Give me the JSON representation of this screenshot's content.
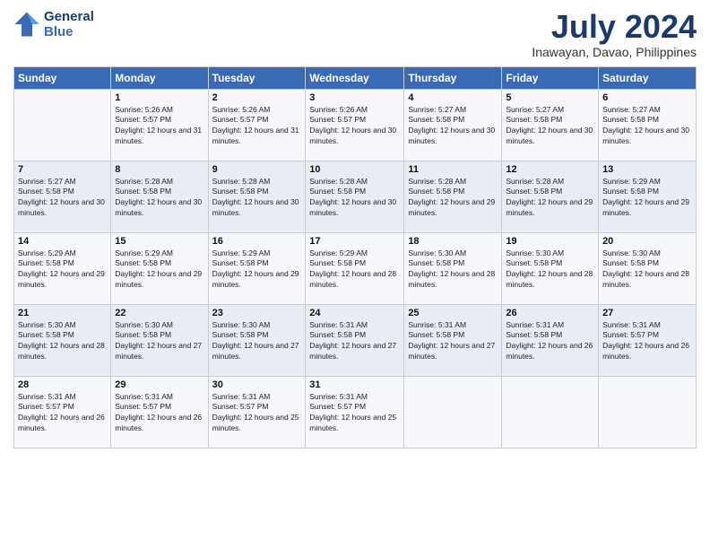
{
  "logo": {
    "line1": "General",
    "line2": "Blue"
  },
  "title": "July 2024",
  "location": "Inawayan, Davao, Philippines",
  "days_of_week": [
    "Sunday",
    "Monday",
    "Tuesday",
    "Wednesday",
    "Thursday",
    "Friday",
    "Saturday"
  ],
  "weeks": [
    [
      {
        "day": "",
        "sunrise": "",
        "sunset": "",
        "daylight": ""
      },
      {
        "day": "1",
        "sunrise": "Sunrise: 5:26 AM",
        "sunset": "Sunset: 5:57 PM",
        "daylight": "Daylight: 12 hours and 31 minutes."
      },
      {
        "day": "2",
        "sunrise": "Sunrise: 5:26 AM",
        "sunset": "Sunset: 5:57 PM",
        "daylight": "Daylight: 12 hours and 31 minutes."
      },
      {
        "day": "3",
        "sunrise": "Sunrise: 5:26 AM",
        "sunset": "Sunset: 5:57 PM",
        "daylight": "Daylight: 12 hours and 30 minutes."
      },
      {
        "day": "4",
        "sunrise": "Sunrise: 5:27 AM",
        "sunset": "Sunset: 5:58 PM",
        "daylight": "Daylight: 12 hours and 30 minutes."
      },
      {
        "day": "5",
        "sunrise": "Sunrise: 5:27 AM",
        "sunset": "Sunset: 5:58 PM",
        "daylight": "Daylight: 12 hours and 30 minutes."
      },
      {
        "day": "6",
        "sunrise": "Sunrise: 5:27 AM",
        "sunset": "Sunset: 5:58 PM",
        "daylight": "Daylight: 12 hours and 30 minutes."
      }
    ],
    [
      {
        "day": "7",
        "sunrise": "Sunrise: 5:27 AM",
        "sunset": "Sunset: 5:58 PM",
        "daylight": "Daylight: 12 hours and 30 minutes."
      },
      {
        "day": "8",
        "sunrise": "Sunrise: 5:28 AM",
        "sunset": "Sunset: 5:58 PM",
        "daylight": "Daylight: 12 hours and 30 minutes."
      },
      {
        "day": "9",
        "sunrise": "Sunrise: 5:28 AM",
        "sunset": "Sunset: 5:58 PM",
        "daylight": "Daylight: 12 hours and 30 minutes."
      },
      {
        "day": "10",
        "sunrise": "Sunrise: 5:28 AM",
        "sunset": "Sunset: 5:58 PM",
        "daylight": "Daylight: 12 hours and 30 minutes."
      },
      {
        "day": "11",
        "sunrise": "Sunrise: 5:28 AM",
        "sunset": "Sunset: 5:58 PM",
        "daylight": "Daylight: 12 hours and 29 minutes."
      },
      {
        "day": "12",
        "sunrise": "Sunrise: 5:28 AM",
        "sunset": "Sunset: 5:58 PM",
        "daylight": "Daylight: 12 hours and 29 minutes."
      },
      {
        "day": "13",
        "sunrise": "Sunrise: 5:29 AM",
        "sunset": "Sunset: 5:58 PM",
        "daylight": "Daylight: 12 hours and 29 minutes."
      }
    ],
    [
      {
        "day": "14",
        "sunrise": "Sunrise: 5:29 AM",
        "sunset": "Sunset: 5:58 PM",
        "daylight": "Daylight: 12 hours and 29 minutes."
      },
      {
        "day": "15",
        "sunrise": "Sunrise: 5:29 AM",
        "sunset": "Sunset: 5:58 PM",
        "daylight": "Daylight: 12 hours and 29 minutes."
      },
      {
        "day": "16",
        "sunrise": "Sunrise: 5:29 AM",
        "sunset": "Sunset: 5:58 PM",
        "daylight": "Daylight: 12 hours and 29 minutes."
      },
      {
        "day": "17",
        "sunrise": "Sunrise: 5:29 AM",
        "sunset": "Sunset: 5:58 PM",
        "daylight": "Daylight: 12 hours and 28 minutes."
      },
      {
        "day": "18",
        "sunrise": "Sunrise: 5:30 AM",
        "sunset": "Sunset: 5:58 PM",
        "daylight": "Daylight: 12 hours and 28 minutes."
      },
      {
        "day": "19",
        "sunrise": "Sunrise: 5:30 AM",
        "sunset": "Sunset: 5:58 PM",
        "daylight": "Daylight: 12 hours and 28 minutes."
      },
      {
        "day": "20",
        "sunrise": "Sunrise: 5:30 AM",
        "sunset": "Sunset: 5:58 PM",
        "daylight": "Daylight: 12 hours and 28 minutes."
      }
    ],
    [
      {
        "day": "21",
        "sunrise": "Sunrise: 5:30 AM",
        "sunset": "Sunset: 5:58 PM",
        "daylight": "Daylight: 12 hours and 28 minutes."
      },
      {
        "day": "22",
        "sunrise": "Sunrise: 5:30 AM",
        "sunset": "Sunset: 5:58 PM",
        "daylight": "Daylight: 12 hours and 27 minutes."
      },
      {
        "day": "23",
        "sunrise": "Sunrise: 5:30 AM",
        "sunset": "Sunset: 5:58 PM",
        "daylight": "Daylight: 12 hours and 27 minutes."
      },
      {
        "day": "24",
        "sunrise": "Sunrise: 5:31 AM",
        "sunset": "Sunset: 5:58 PM",
        "daylight": "Daylight: 12 hours and 27 minutes."
      },
      {
        "day": "25",
        "sunrise": "Sunrise: 5:31 AM",
        "sunset": "Sunset: 5:58 PM",
        "daylight": "Daylight: 12 hours and 27 minutes."
      },
      {
        "day": "26",
        "sunrise": "Sunrise: 5:31 AM",
        "sunset": "Sunset: 5:58 PM",
        "daylight": "Daylight: 12 hours and 26 minutes."
      },
      {
        "day": "27",
        "sunrise": "Sunrise: 5:31 AM",
        "sunset": "Sunset: 5:57 PM",
        "daylight": "Daylight: 12 hours and 26 minutes."
      }
    ],
    [
      {
        "day": "28",
        "sunrise": "Sunrise: 5:31 AM",
        "sunset": "Sunset: 5:57 PM",
        "daylight": "Daylight: 12 hours and 26 minutes."
      },
      {
        "day": "29",
        "sunrise": "Sunrise: 5:31 AM",
        "sunset": "Sunset: 5:57 PM",
        "daylight": "Daylight: 12 hours and 26 minutes."
      },
      {
        "day": "30",
        "sunrise": "Sunrise: 5:31 AM",
        "sunset": "Sunset: 5:57 PM",
        "daylight": "Daylight: 12 hours and 25 minutes."
      },
      {
        "day": "31",
        "sunrise": "Sunrise: 5:31 AM",
        "sunset": "Sunset: 5:57 PM",
        "daylight": "Daylight: 12 hours and 25 minutes."
      },
      {
        "day": "",
        "sunrise": "",
        "sunset": "",
        "daylight": ""
      },
      {
        "day": "",
        "sunrise": "",
        "sunset": "",
        "daylight": ""
      },
      {
        "day": "",
        "sunrise": "",
        "sunset": "",
        "daylight": ""
      }
    ]
  ]
}
